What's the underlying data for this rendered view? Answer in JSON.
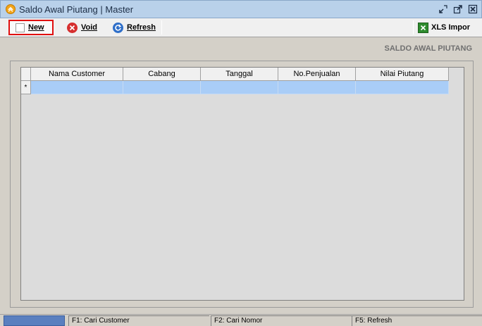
{
  "window": {
    "title": "Saldo Awal Piutang | Master",
    "controls": [
      "restore-icon",
      "popout-icon",
      "close-icon"
    ]
  },
  "toolbar": {
    "new_label": "New",
    "void_label": "Void",
    "refresh_label": "Refresh",
    "xls_label": "XLS Impor",
    "colors": {
      "highlight": "#e01010",
      "void": "#d62f2f",
      "refresh": "#2f6fc9",
      "xls": "#2e8b2e"
    }
  },
  "section": {
    "title": "SALDO AWAL PIUTANG"
  },
  "grid": {
    "columns": [
      "Nama Customer",
      "Cabang",
      "Tanggal",
      "No.Penjualan",
      "Nilai Piutang"
    ],
    "new_row_marker": "*",
    "rows": []
  },
  "statusbar": {
    "f1": "F1: Cari Customer",
    "f2": "F2: Cari Nomor",
    "f5": "F5: Refresh"
  }
}
